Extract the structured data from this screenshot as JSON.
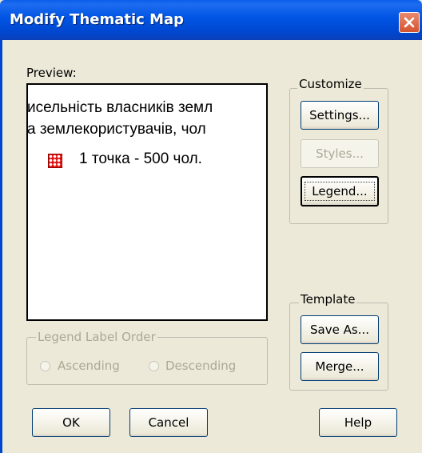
{
  "window": {
    "title": "Modify Thematic Map"
  },
  "preview": {
    "label": "Preview:",
    "lines": [
      "исельність власників земл",
      "а землекористувачів, чол"
    ],
    "legend_item": "1 точка -  500 чол.",
    "legend_icon": "red-dot-pattern-icon"
  },
  "customize": {
    "title": "Customize",
    "settings_label": "Settings...",
    "styles_label": "Styles...",
    "legend_label": "Legend..."
  },
  "template": {
    "title": "Template",
    "save_as_label": "Save As...",
    "merge_label": "Merge..."
  },
  "legend_order": {
    "title": "Legend Label Order",
    "ascending_label": "Ascending",
    "descending_label": "Descending"
  },
  "footer": {
    "ok_label": "OK",
    "cancel_label": "Cancel",
    "help_label": "Help"
  },
  "colors": {
    "title_bar": "#0054e3",
    "close_button": "#d5542f",
    "dialog_bg": "#ece9d8"
  }
}
